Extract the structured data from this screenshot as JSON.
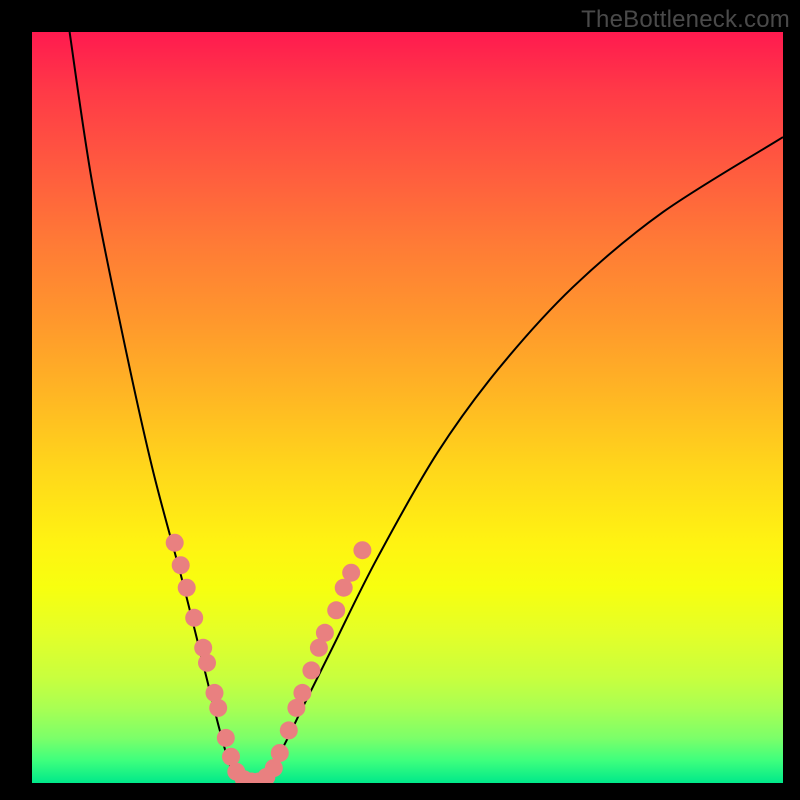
{
  "watermark": "TheBottleneck.com",
  "chart_data": {
    "type": "line",
    "title": "",
    "xlabel": "",
    "ylabel": "",
    "xlim": [
      0,
      100
    ],
    "ylim": [
      0,
      100
    ],
    "grid": false,
    "legend": false,
    "background_gradient": {
      "orientation": "vertical",
      "stops": [
        {
          "pos": 0,
          "color": "#ff1a4f"
        },
        {
          "pos": 50,
          "color": "#ffd61b"
        },
        {
          "pos": 100,
          "color": "#00e98a"
        }
      ]
    },
    "series": [
      {
        "name": "bottleneck-curve",
        "x": [
          5,
          8,
          12,
          16,
          20,
          23,
          25,
          26.5,
          28,
          30,
          33,
          36,
          40,
          46,
          54,
          62,
          72,
          84,
          100
        ],
        "y": [
          100,
          80,
          60,
          42,
          27,
          15,
          7,
          2,
          0,
          0,
          4,
          10,
          18,
          30,
          44,
          55,
          66,
          76,
          86
        ]
      }
    ],
    "markers": {
      "name": "highlight-dots",
      "color": "#e98080",
      "points": [
        {
          "x": 19.0,
          "y": 32
        },
        {
          "x": 19.8,
          "y": 29
        },
        {
          "x": 20.6,
          "y": 26
        },
        {
          "x": 21.6,
          "y": 22
        },
        {
          "x": 22.8,
          "y": 18
        },
        {
          "x": 23.3,
          "y": 16
        },
        {
          "x": 24.3,
          "y": 12
        },
        {
          "x": 24.8,
          "y": 10
        },
        {
          "x": 25.8,
          "y": 6
        },
        {
          "x": 26.5,
          "y": 3.5
        },
        {
          "x": 27.2,
          "y": 1.5
        },
        {
          "x": 28.2,
          "y": 0.5
        },
        {
          "x": 29.2,
          "y": 0.2
        },
        {
          "x": 30.2,
          "y": 0.2
        },
        {
          "x": 31.2,
          "y": 0.8
        },
        {
          "x": 32.2,
          "y": 2
        },
        {
          "x": 33.0,
          "y": 4
        },
        {
          "x": 34.2,
          "y": 7
        },
        {
          "x": 35.2,
          "y": 10
        },
        {
          "x": 36.0,
          "y": 12
        },
        {
          "x": 37.2,
          "y": 15
        },
        {
          "x": 38.2,
          "y": 18
        },
        {
          "x": 39.0,
          "y": 20
        },
        {
          "x": 40.5,
          "y": 23
        },
        {
          "x": 41.5,
          "y": 26
        },
        {
          "x": 42.5,
          "y": 28
        },
        {
          "x": 44.0,
          "y": 31
        }
      ]
    }
  }
}
